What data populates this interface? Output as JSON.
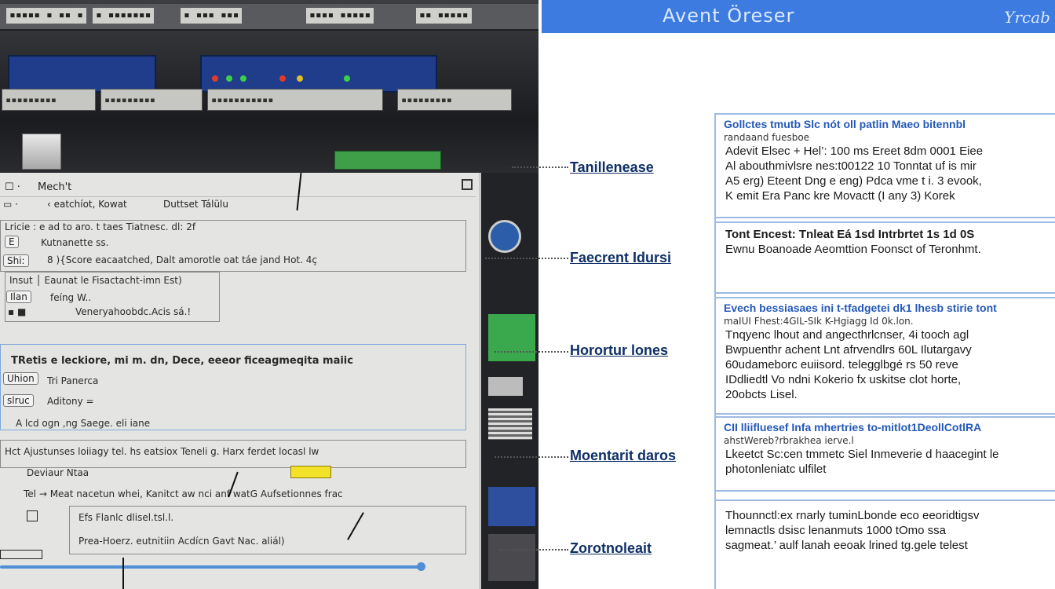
{
  "photo": {
    "rack_labels": [
      "▪▪▪▪▪ ▪ ▪▪ ▪",
      "▪ ▪▪▪▪▪▪▪",
      "▪ ▪▪▪ ▪▪▪",
      "▪▪▪▪ ▪▪▪▪▪",
      "▪▪ ▪▪▪▪▪"
    ],
    "port_labels": [
      "▪▪▪▪▪▪▪▪▪",
      "▪▪▪▪▪▪▪▪▪",
      "▪▪▪▪▪▪▪▪▪▪▪",
      "▪▪▪▪▪▪▪▪▪"
    ],
    "window": {
      "title": "Mech't",
      "toolbar": [
        "‹ eatchíot, Kowat",
        "Duttset Tálülu"
      ],
      "header_line": "Lricie : e ad to aro. t taes Tiatnesc. dl: 2f",
      "row1_tag": "E",
      "row1_text": "Kutnanette ss.",
      "row2_tag": "Shi:",
      "row2_text": "8  ){Score eacaatched, Dalt amorotle  oat  táe  jand Hot.  4ç",
      "sub_box_title": "Insut │ Eaunat le Fisactacht-imn Est)",
      "sub_tag1": "Ilan",
      "sub_text1": "feíng W..",
      "sub_text2": "Veneryahoobdc.Acis  sá.!",
      "section_title": "TRetis e leckiore, mi m. dn, Dece, eeeor ficeagmeqita maiic",
      "tag_union": "Uhion",
      "text_union": "Tri Panerca",
      "tag_siuc": "slruc",
      "text_adone": "Aditony =",
      "line_fl": "A  lcd ogn ,ng Saege. eli iane",
      "line_ajustments": "Hct  Ajustunses loiiagy  tel. hs eatsiox  Teneli g. Harx ferdet  locasl  lw",
      "line_deviaur": "Deviaur  Ntaa",
      "line_mead": "Tel   →   Meat nacetun  whei, Kanitct aw  nci anf watG  Aufsetionnes frac",
      "line_bottom1": "Efs  Flanlc  dlisel.tsl.l.",
      "line_bottom2": "Prea-Hoerz.  eutnitiin Acdícn Gavt  Nac. aliál)"
    }
  },
  "doc": {
    "header_title": "Avent Öreser",
    "header_brand": "Yrcab",
    "callouts": [
      "Tanillenease",
      "Faecrent Idursi",
      "Horortur lones",
      "Moentarit daros",
      "Zorotnoleait"
    ],
    "boxes": [
      {
        "head": "Gollctes tmutb Slc nót oll patlin Maeo bitennbl",
        "sub": "randaand fuesboe",
        "lines": [
          "Adevit Elsec +  Hel’: 100 ms  Ereet  8dm 0001  Eiee",
          "Al abouthmivlsre nes:t00122 10 Tonntat uf is mir",
          "A5 erg) Eteent Dng e eng) Pdca vme t i. 3 evook,",
          "K emit Era Panc kre Movactt (I any 3) Korek"
        ]
      },
      {
        "head": "",
        "sub": "",
        "lines": [
          "Tont Encest: Tnleat Eá 1sd Intrbrtet 1s 1d 0S",
          "Ewnu Boanoade Aeomttion Foonsct of Teronhmt."
        ]
      },
      {
        "head": "Evech bessiasaes ini t-tfadgetei dk1 lhesb stirie tont",
        "sub": "maIUI Fhest:4GIL-SIk K-Hgiagg Id 0k.lon.",
        "lines": [
          "Tnqyenc lhout and angecthrlcnser, 4i tooch agl",
          "Bwpuenthr achent Lnt afrvendlrs 60L Ilutargavy",
          "60udameborc euiisord. telegglbgé rs  50 reve",
          "IDdliedtl Vo ndni Kokerio fx uskitse clot horte,",
          "20obcts Lisel."
        ]
      },
      {
        "head": "CII lliifluesef Infa mhertries to-mitlot1DeollCotlRA",
        "sub": "ahstWereb?rbrakhea ierve.l",
        "lines": [
          "Lkeetct Sc:cen tmmetc Siel Inmeverie d haacegint le",
          "photonleniatc ulfilet"
        ]
      },
      {
        "head": "",
        "sub": "",
        "lines": [
          "Thounnctl:ex rnarly tuminLbonde eco eeoridtigsv",
          "lemnactls dsisc lenanmuts 1000 tOmo ssa",
          "sagmeat.’ aulf lanah eeoak lrined tg.gele telest"
        ]
      }
    ]
  }
}
